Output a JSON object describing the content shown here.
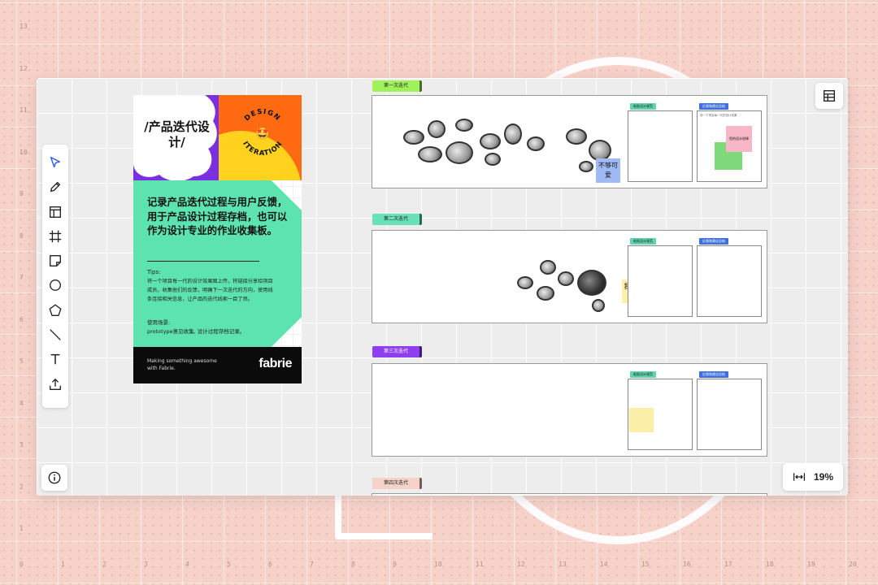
{
  "ruler": {
    "left": [
      "13",
      "12",
      "11",
      "10",
      "9",
      "8",
      "7",
      "6",
      "5",
      "4",
      "3",
      "2",
      "1"
    ],
    "bottom": [
      "0",
      "1",
      "2",
      "3",
      "4",
      "5",
      "6",
      "7",
      "8",
      "9",
      "10",
      "11",
      "12",
      "13",
      "14",
      "15",
      "16",
      "17",
      "18",
      "19",
      "20"
    ]
  },
  "toolbar": {
    "tools": [
      "select-tool",
      "pen-tool",
      "template-tool",
      "frame-tool",
      "sticky-note-tool",
      "circle-tool",
      "polygon-tool",
      "line-tool",
      "text-tool",
      "upload-tool"
    ],
    "accent": "#2f5cf5"
  },
  "zoom": {
    "value": "19%"
  },
  "poster": {
    "title": "/产品迭代设计/",
    "badge": {
      "top": "DESIGN",
      "bottom": "ITERATION",
      "emoji": "🤩"
    },
    "headline": "记录产品迭代过程与用户反馈，用于产品设计过程存档，也可以作为设计专业的作业收集板。",
    "tips_label": "Tips:",
    "tips_body": "将一个项目每一代的设计效果图上传，将链接分享给项目成员，收集他们的反馈，明确下一次迭代的方向，使用线条连接相关信息，让产品的迭代线索一目了然。",
    "usage_label": "使用场景:",
    "usage_body": "prototype意见收集, 设计过程存档记录。",
    "footer_text": "Making something awesome with Fabrie.",
    "logo": "fabrie",
    "colors": {
      "purple": "#7b2fe3",
      "orange": "#ff6a13",
      "yellow": "#ffd21e",
      "green": "#5de3b0"
    }
  },
  "iterations": [
    {
      "label": "第一次迭代",
      "color": "#9ff25a",
      "card_a": "粘贴设计规范",
      "card_b": "反馈和建议总结",
      "card_b_note": "将一个项目每一代的设计效果",
      "sticky": "不够可爱",
      "sticky_pink": "您的设计很棒"
    },
    {
      "label": "第二次迭代",
      "color": "#68e2b6",
      "card_a": "粘贴设计规范",
      "card_b": "反馈和建议总结",
      "sticky": "我太喜欢了"
    },
    {
      "label": "第三次迭代",
      "color": "#8f3ff0",
      "card_a": "粘贴设计规范",
      "card_b": "反馈和建议总结"
    },
    {
      "label": "第四次迭代",
      "color": "#f6d3c8"
    }
  ]
}
